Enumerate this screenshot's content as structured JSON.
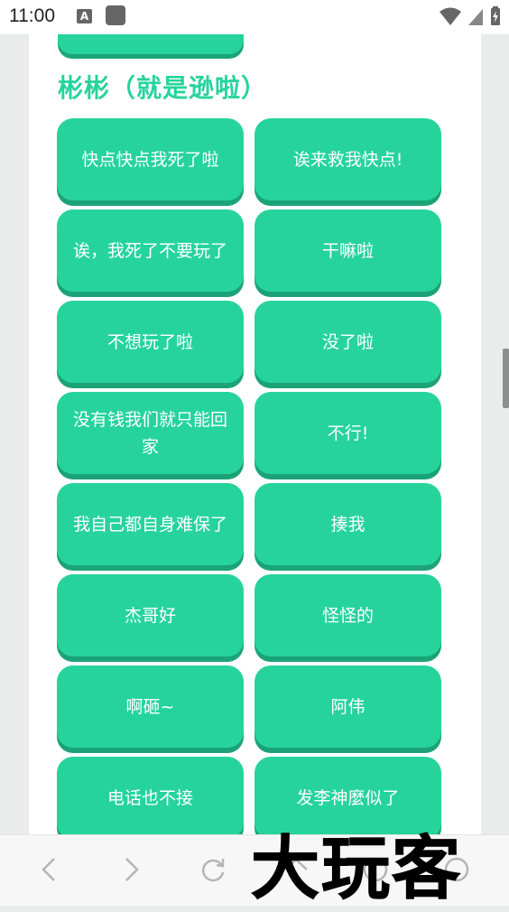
{
  "status_bar": {
    "time": "11:00",
    "notification_icon_letter": "A",
    "icons": [
      "keyboard-icon",
      "app-square-icon",
      "wifi-icon",
      "signal-icon",
      "battery-charging-icon"
    ]
  },
  "section": {
    "title": "彬彬（就是逊啦）"
  },
  "buttons": [
    {
      "label": "快点快点我死了啦"
    },
    {
      "label": "诶来救我快点!"
    },
    {
      "label": "诶，我死了不要玩了"
    },
    {
      "label": "干嘛啦"
    },
    {
      "label": "不想玩了啦"
    },
    {
      "label": "没了啦"
    },
    {
      "label": "没有钱我们就只能回家"
    },
    {
      "label": "不行!"
    },
    {
      "label": "我自己都自身难保了"
    },
    {
      "label": "揍我"
    },
    {
      "label": "杰哥好"
    },
    {
      "label": "怪怪的"
    },
    {
      "label": "啊砸~"
    },
    {
      "label": "阿伟"
    },
    {
      "label": "电话也不接"
    },
    {
      "label": "发李神麼似了"
    }
  ],
  "bottom_nav": {
    "icons": [
      "back-icon",
      "forward-icon",
      "reload-icon",
      "home-icon",
      "info-icon",
      "menu-icon"
    ]
  },
  "watermark": {
    "text": "大玩客"
  },
  "colors": {
    "accent": "#26d49b",
    "accent_shadow": "#1ba377",
    "background": "#e9ecea",
    "card": "#ffffff"
  }
}
